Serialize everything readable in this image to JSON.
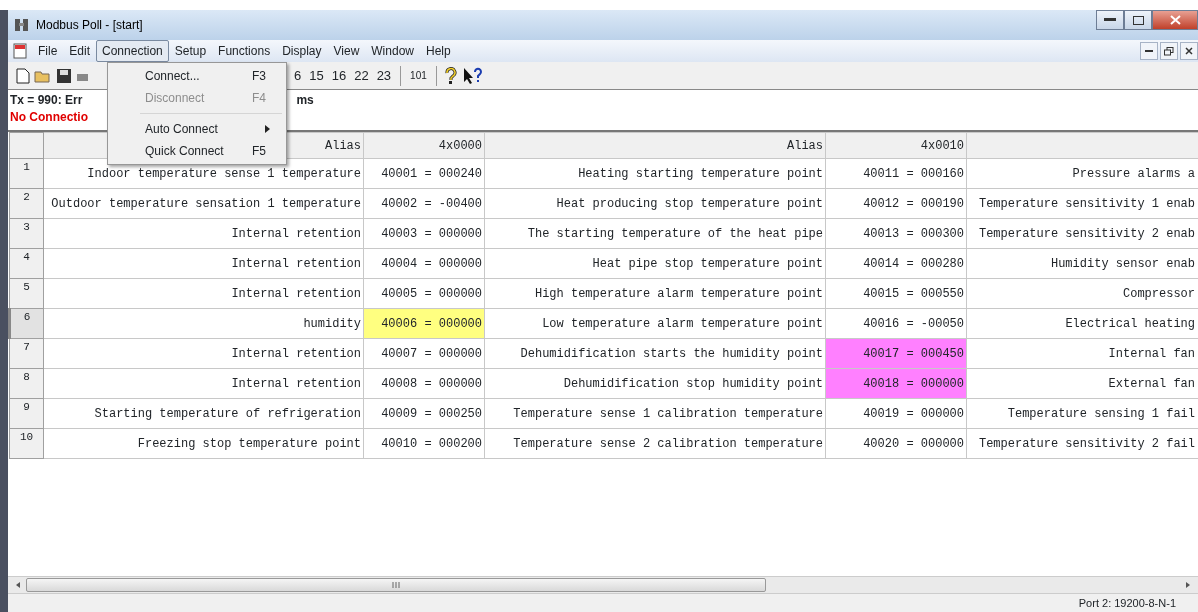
{
  "window": {
    "title": "Modbus Poll - [start]"
  },
  "menu": [
    {
      "label": "File",
      "selected": false
    },
    {
      "label": "Edit",
      "selected": false
    },
    {
      "label": "Connection",
      "selected": true
    },
    {
      "label": "Setup",
      "selected": false
    },
    {
      "label": "Functions",
      "selected": false
    },
    {
      "label": "Display",
      "selected": false
    },
    {
      "label": "View",
      "selected": false
    },
    {
      "label": "Window",
      "selected": false
    },
    {
      "label": "Help",
      "selected": false
    }
  ],
  "dropdown": [
    {
      "kind": "item",
      "label": "Connect...",
      "shortcut": "F3",
      "disabled": false
    },
    {
      "kind": "item",
      "label": "Disconnect",
      "shortcut": "F4",
      "disabled": true
    },
    {
      "kind": "separator"
    },
    {
      "kind": "submenu",
      "label": "Auto Connect",
      "disabled": false
    },
    {
      "kind": "item",
      "label": "Quick Connect",
      "shortcut": "F5",
      "disabled": false
    }
  ],
  "toolbar": {
    "function_codes": [
      "6",
      "15",
      "16",
      "22",
      "23"
    ],
    "address_button": "101"
  },
  "info": {
    "tx": "Tx = 990: Err",
    "tx_tail": "ms",
    "connection": "No Connectio"
  },
  "table": {
    "columns": [
      "Alias",
      "4x0000",
      "Alias",
      "4x0010"
    ],
    "rows": [
      {
        "number": "1",
        "selected": false,
        "alias": "Indoor temperature sense 1 temperature",
        "value": {
          "text": "40001 = 000240"
        },
        "alias_2": "Heating starting temperature point",
        "value_2": {
          "text": "40011 = 000160"
        },
        "column_5": "Pressure alarms a"
      },
      {
        "number": "2",
        "selected": false,
        "alias": "Outdoor temperature sensation 1 temperature",
        "value": {
          "text": "40002 = -00400"
        },
        "alias_2": "Heat producing stop temperature point",
        "value_2": {
          "text": "40012 = 000190"
        },
        "column_5": "Temperature sensitivity 1 enab"
      },
      {
        "number": "3",
        "selected": false,
        "alias": "Internal retention",
        "value": {
          "text": "40003 = 000000"
        },
        "alias_2": "The starting temperature of the heat pipe",
        "value_2": {
          "text": "40013 = 000300"
        },
        "column_5": "Temperature sensitivity 2 enab"
      },
      {
        "number": "4",
        "selected": false,
        "alias": "Internal retention",
        "value": {
          "text": "40004 = 000000"
        },
        "alias_2": "Heat pipe stop temperature point",
        "value_2": {
          "text": "40014 = 000280"
        },
        "column_5": "Humidity sensor enab"
      },
      {
        "number": "5",
        "selected": false,
        "alias": "Internal retention",
        "value": {
          "text": "40005 = 000000"
        },
        "alias_2": "High temperature alarm temperature point",
        "value_2": {
          "text": "40015 = 000550"
        },
        "column_5": "Compressor"
      },
      {
        "number": "6",
        "selected": true,
        "alias": "humidity",
        "value": {
          "text": "40006 = 000000",
          "color": "#ffff80"
        },
        "alias_2": "Low temperature alarm temperature point",
        "value_2": {
          "text": "40016 = -00050"
        },
        "column_5": "Electrical heating"
      },
      {
        "number": "7",
        "selected": false,
        "alias": "Internal retention",
        "value": {
          "text": "40007 = 000000"
        },
        "alias_2": "Dehumidification starts the humidity point",
        "value_2": {
          "text": "40017 = 000450",
          "color": "#ff80ff"
        },
        "column_5": "Internal fan"
      },
      {
        "number": "8",
        "selected": false,
        "alias": "Internal retention",
        "value": {
          "text": "40008 = 000000"
        },
        "alias_2": "Dehumidification stop humidity point",
        "value_2": {
          "text": "40018 = 000000",
          "color": "#ff80ff"
        },
        "column_5": "External fan"
      },
      {
        "number": "9",
        "selected": false,
        "alias": "Starting temperature of refrigeration",
        "value": {
          "text": "40009 = 000250"
        },
        "alias_2": "Temperature sense 1 calibration temperature",
        "value_2": {
          "text": "40019 = 000000"
        },
        "column_5": "Temperature sensing 1 fail"
      },
      {
        "number": "10",
        "selected": false,
        "alias": "Freezing stop temperature point",
        "value": {
          "text": "40010 = 000200"
        },
        "alias_2": "Temperature sense 2 calibration temperature",
        "value_2": {
          "text": "40020 = 000000"
        },
        "column_5": "Temperature sensitivity 2 fail"
      }
    ]
  },
  "status_bar": {
    "port": "Port 2: 19200-8-N-1"
  }
}
